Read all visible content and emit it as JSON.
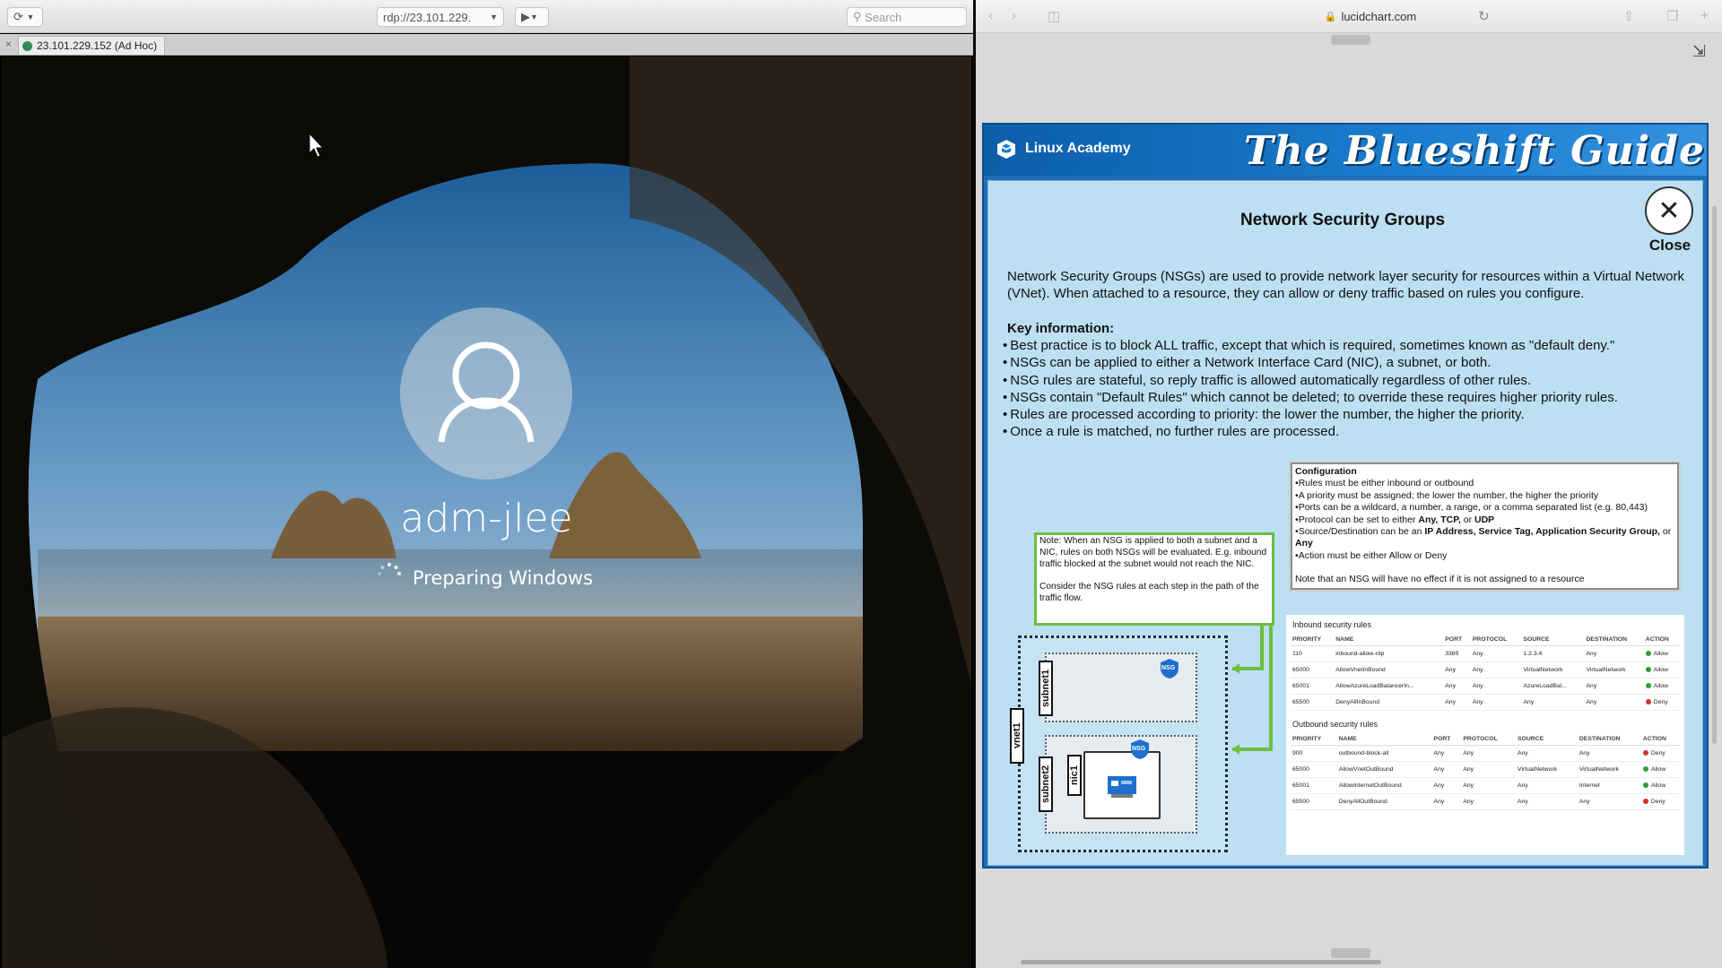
{
  "left_window": {
    "toolbar": {
      "url": "rdp://23.101.229.",
      "search_placeholder": "Search"
    },
    "tab": {
      "label": "23.101.229.152 (Ad Hoc)"
    },
    "login": {
      "username": "adm-jlee",
      "status": "Preparing Windows"
    }
  },
  "right_window": {
    "url": "lucidchart.com",
    "slide": {
      "brand": "Linux Academy",
      "guide_title": "The Blueshift Guide",
      "title": "Network Security Groups",
      "close_label": "Close",
      "intro": "Network Security Groups (NSGs) are used to provide network layer security for resources within a Virtual Network (VNet). When attached to a resource, they can allow or deny traffic based on rules you configure.",
      "key_heading": "Key information:",
      "key_points": [
        "Best practice is to block ALL traffic, except that which is required, sometimes known as \"default deny.\"",
        "NSGs can be applied to either a Network Interface Card (NIC), a subnet, or both.",
        "NSG rules are stateful, so reply traffic is allowed automatically regardless of other rules.",
        "NSGs contain \"Default Rules\" which cannot be deleted; to override these requires higher priority rules.",
        "Rules are processed according to priority: the lower the number, the higher the priority.",
        "Once a rule is matched, no further rules are processed."
      ],
      "configuration": {
        "title": "Configuration",
        "lines": [
          "Rules must be either inbound or outbound",
          "A priority must be assigned; the lower the number, the higher the priority",
          "Ports can be a wildcard, a number, a range, or a comma separated list (e.g. 80,443)"
        ],
        "protocol_prefix": "Protocol can be set to either ",
        "protocol_values": "Any, TCP,",
        "protocol_or": " or ",
        "protocol_last": "UDP",
        "source_prefix": "Source/Destination can be an ",
        "source_values": "IP Address, Service Tag, Application Security Group,",
        "source_or": " or ",
        "source_last": "Any",
        "action_line": "Action must be either Allow or Deny",
        "footer": "Note that an NSG will have no effect if it is not assigned to a resource"
      },
      "note": {
        "p1": "Note: When an NSG is applied to both a subnet and a NIC, rules on both NSGs will be evaluated. E.g. inbound traffic blocked at the subnet would not reach the NIC.",
        "p2": "Consider the NSG rules at each step in the path of the traffic flow."
      },
      "diagram_labels": {
        "vnet": "vnet1",
        "subnet1": "subnet1",
        "subnet2": "subnet2",
        "nic": "nic1",
        "nsg": "NSG"
      },
      "inbound": {
        "caption": "Inbound security rules",
        "headers": [
          "PRIORITY",
          "NAME",
          "PORT",
          "PROTOCOL",
          "SOURCE",
          "DESTINATION",
          "ACTION"
        ],
        "rows": [
          [
            "110",
            "inbound-allow-rdp",
            "3389",
            "Any",
            "1.2.3.4",
            "Any",
            "Allow"
          ],
          [
            "65000",
            "AllowVnetInBound",
            "Any",
            "Any",
            "VirtualNetwork",
            "VirtualNetwork",
            "Allow"
          ],
          [
            "65001",
            "AllowAzureLoadBalancerIn...",
            "Any",
            "Any",
            "AzureLoadBal...",
            "Any",
            "Allow"
          ],
          [
            "65500",
            "DenyAllInBound",
            "Any",
            "Any",
            "Any",
            "Any",
            "Deny"
          ]
        ]
      },
      "outbound": {
        "caption": "Outbound security rules",
        "headers": [
          "PRIORITY",
          "NAME",
          "PORT",
          "PROTOCOL",
          "SOURCE",
          "DESTINATION",
          "ACTION"
        ],
        "rows": [
          [
            "900",
            "outbound-block-all",
            "Any",
            "Any",
            "Any",
            "Any",
            "Deny"
          ],
          [
            "65000",
            "AllowVnetOutBound",
            "Any",
            "Any",
            "VirtualNetwork",
            "VirtualNetwork",
            "Allow"
          ],
          [
            "65001",
            "AllowInternetOutBound",
            "Any",
            "Any",
            "Any",
            "Internet",
            "Allow"
          ],
          [
            "65500",
            "DenyAllOutBound",
            "Any",
            "Any",
            "Any",
            "Any",
            "Deny"
          ]
        ]
      }
    }
  },
  "colors": {
    "allow": "#2e9d3a",
    "deny": "#d0312d",
    "accent": "#1d6fba"
  }
}
